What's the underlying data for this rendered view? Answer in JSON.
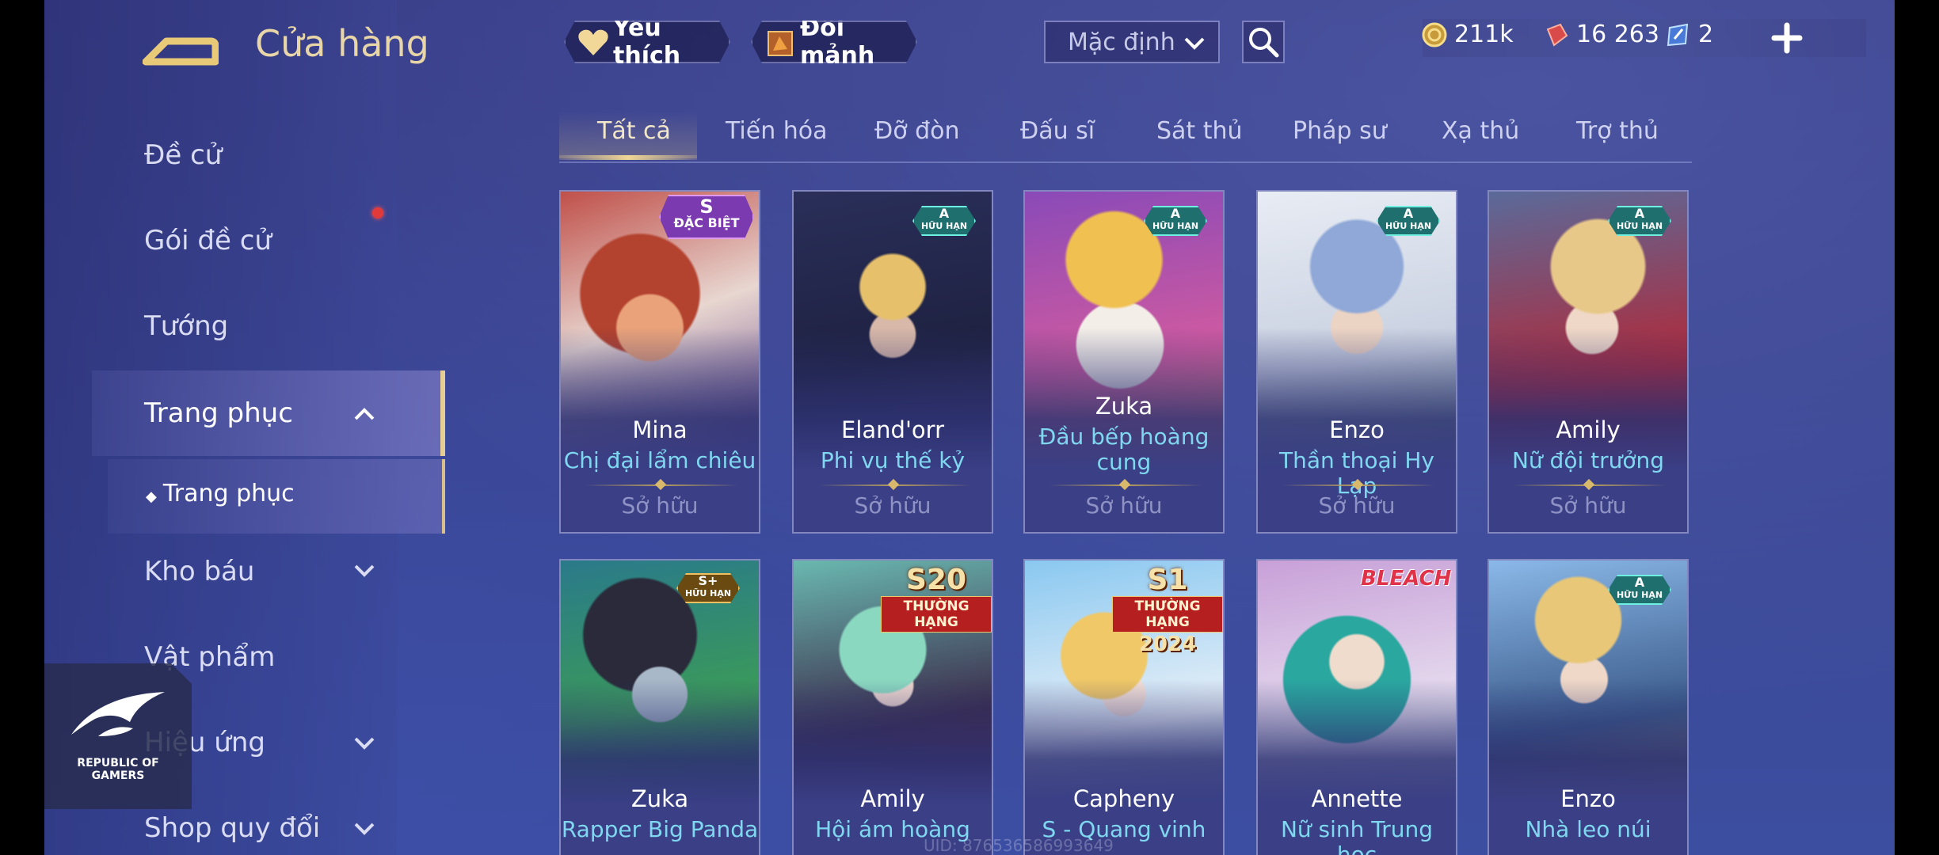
{
  "sidebar": {
    "title": "Cửa hàng",
    "items": [
      {
        "label": "Đề cử"
      },
      {
        "label": "Gói đề cử"
      },
      {
        "label": "Tướng"
      },
      {
        "label": "Trang phục"
      },
      {
        "label": "Trang phục"
      },
      {
        "label": "Kho báu"
      },
      {
        "label": "Vật phẩm"
      },
      {
        "label": "Hiệu ứng"
      },
      {
        "label": "Shop quy đổi"
      }
    ],
    "logo_text": "REPUBLIC OF GAMERS"
  },
  "topbar": {
    "favorites": "Yêu thích",
    "exchange": "Đổi mảnh",
    "sort": "Mặc định",
    "gold": "211k",
    "vouchers": "16 263",
    "tickets": "2"
  },
  "tabs": [
    "Tất cả",
    "Tiến hóa",
    "Đỡ đòn",
    "Đấu sĩ",
    "Sát thủ",
    "Pháp sư",
    "Xạ thủ",
    "Trợ thủ"
  ],
  "cards": [
    {
      "hero": "Mina",
      "skin": "Chị đại lẩm chiêu",
      "status": "Sở hữu",
      "badge_rank": "S",
      "badge_label": "ĐẶC BIỆT"
    },
    {
      "hero": "Eland'orr",
      "skin": "Phi vụ thế kỷ",
      "status": "Sở hữu",
      "badge_rank": "A",
      "badge_label": "HỮU HẠN"
    },
    {
      "hero": "Zuka",
      "skin": "Đầu bếp hoàng cung",
      "status": "Sở hữu",
      "badge_rank": "A",
      "badge_label": "HỮU HẠN"
    },
    {
      "hero": "Enzo",
      "skin": "Thần thoại Hy Lạp",
      "status": "Sở hữu",
      "badge_rank": "A",
      "badge_label": "HỮU HẠN"
    },
    {
      "hero": "Amily",
      "skin": "Nữ đội trưởng",
      "status": "Sở hữu",
      "badge_rank": "A",
      "badge_label": "HỮU HẠN"
    },
    {
      "hero": "Zuka",
      "skin": "Rapper Big Panda",
      "badge_rank": "S+",
      "badge_label": "HỮU HẠN"
    },
    {
      "hero": "Amily",
      "skin": "Hội ám hoàng",
      "banner_big": "S20",
      "banner_ribbon": "THƯỜNG HẠNG"
    },
    {
      "hero": "Capheny",
      "skin": "S - Quang vinh",
      "banner_big": "S1",
      "banner_ribbon": "THƯỜNG HẠNG",
      "banner_year": "2024"
    },
    {
      "hero": "Annette",
      "skin": "Nữ sinh Trung học",
      "banner_brand": "BLEACH"
    },
    {
      "hero": "Enzo",
      "skin": "Nhà leo núi",
      "badge_rank": "A",
      "badge_label": "HỮU HẠN"
    }
  ],
  "watermark": "UID: 876536586993649",
  "colors": {
    "accent_gold": "#e6cf95",
    "skin_name": "#7fd7f0",
    "badge_teal": "#1f6f6f",
    "badge_purple": "#7b3ab0"
  }
}
